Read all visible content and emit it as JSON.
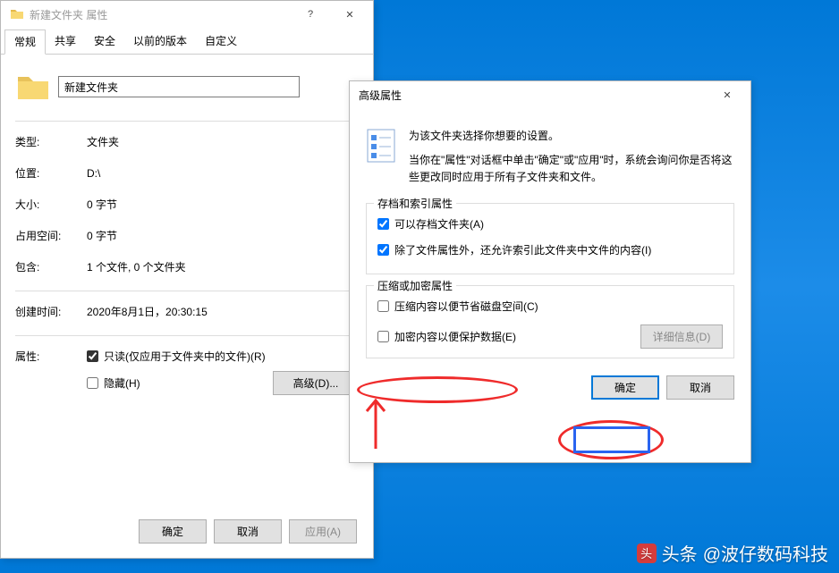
{
  "propsWindow": {
    "title": "新建文件夹 属性",
    "tabs": [
      "常规",
      "共享",
      "安全",
      "以前的版本",
      "自定义"
    ],
    "activeTab": 0,
    "folderName": "新建文件夹",
    "rows": {
      "typeLabel": "类型:",
      "typeValue": "文件夹",
      "locationLabel": "位置:",
      "locationValue": "D:\\",
      "sizeLabel": "大小:",
      "sizeValue": "0 字节",
      "sizeDiskLabel": "占用空间:",
      "sizeDiskValue": "0 字节",
      "containsLabel": "包含:",
      "containsValue": "1 个文件, 0 个文件夹",
      "createdLabel": "创建时间:",
      "createdValue": "2020年8月1日，20:30:15",
      "attrLabel": "属性:"
    },
    "checkboxes": {
      "readonly": "只读(仅应用于文件夹中的文件)(R)",
      "hidden": "隐藏(H)"
    },
    "advancedBtn": "高级(D)...",
    "buttons": {
      "ok": "确定",
      "cancel": "取消",
      "apply": "应用(A)"
    }
  },
  "advancedDialog": {
    "title": "高级属性",
    "intro1": "为该文件夹选择你想要的设置。",
    "intro2": "当你在\"属性\"对话框中单击\"确定\"或\"应用\"时，系统会询问你是否将这些更改同时应用于所有子文件夹和文件。",
    "section1": {
      "legend": "存档和索引属性",
      "archive": "可以存档文件夹(A)",
      "index": "除了文件属性外，还允许索引此文件夹中文件的内容(I)"
    },
    "section2": {
      "legend": "压缩或加密属性",
      "compress": "压缩内容以便节省磁盘空间(C)",
      "encrypt": "加密内容以便保护数据(E)",
      "detailsBtn": "详细信息(D)"
    },
    "buttons": {
      "ok": "确定",
      "cancel": "取消"
    }
  },
  "watermark": {
    "prefix": "头条",
    "handle": "@波仔数码科技"
  }
}
